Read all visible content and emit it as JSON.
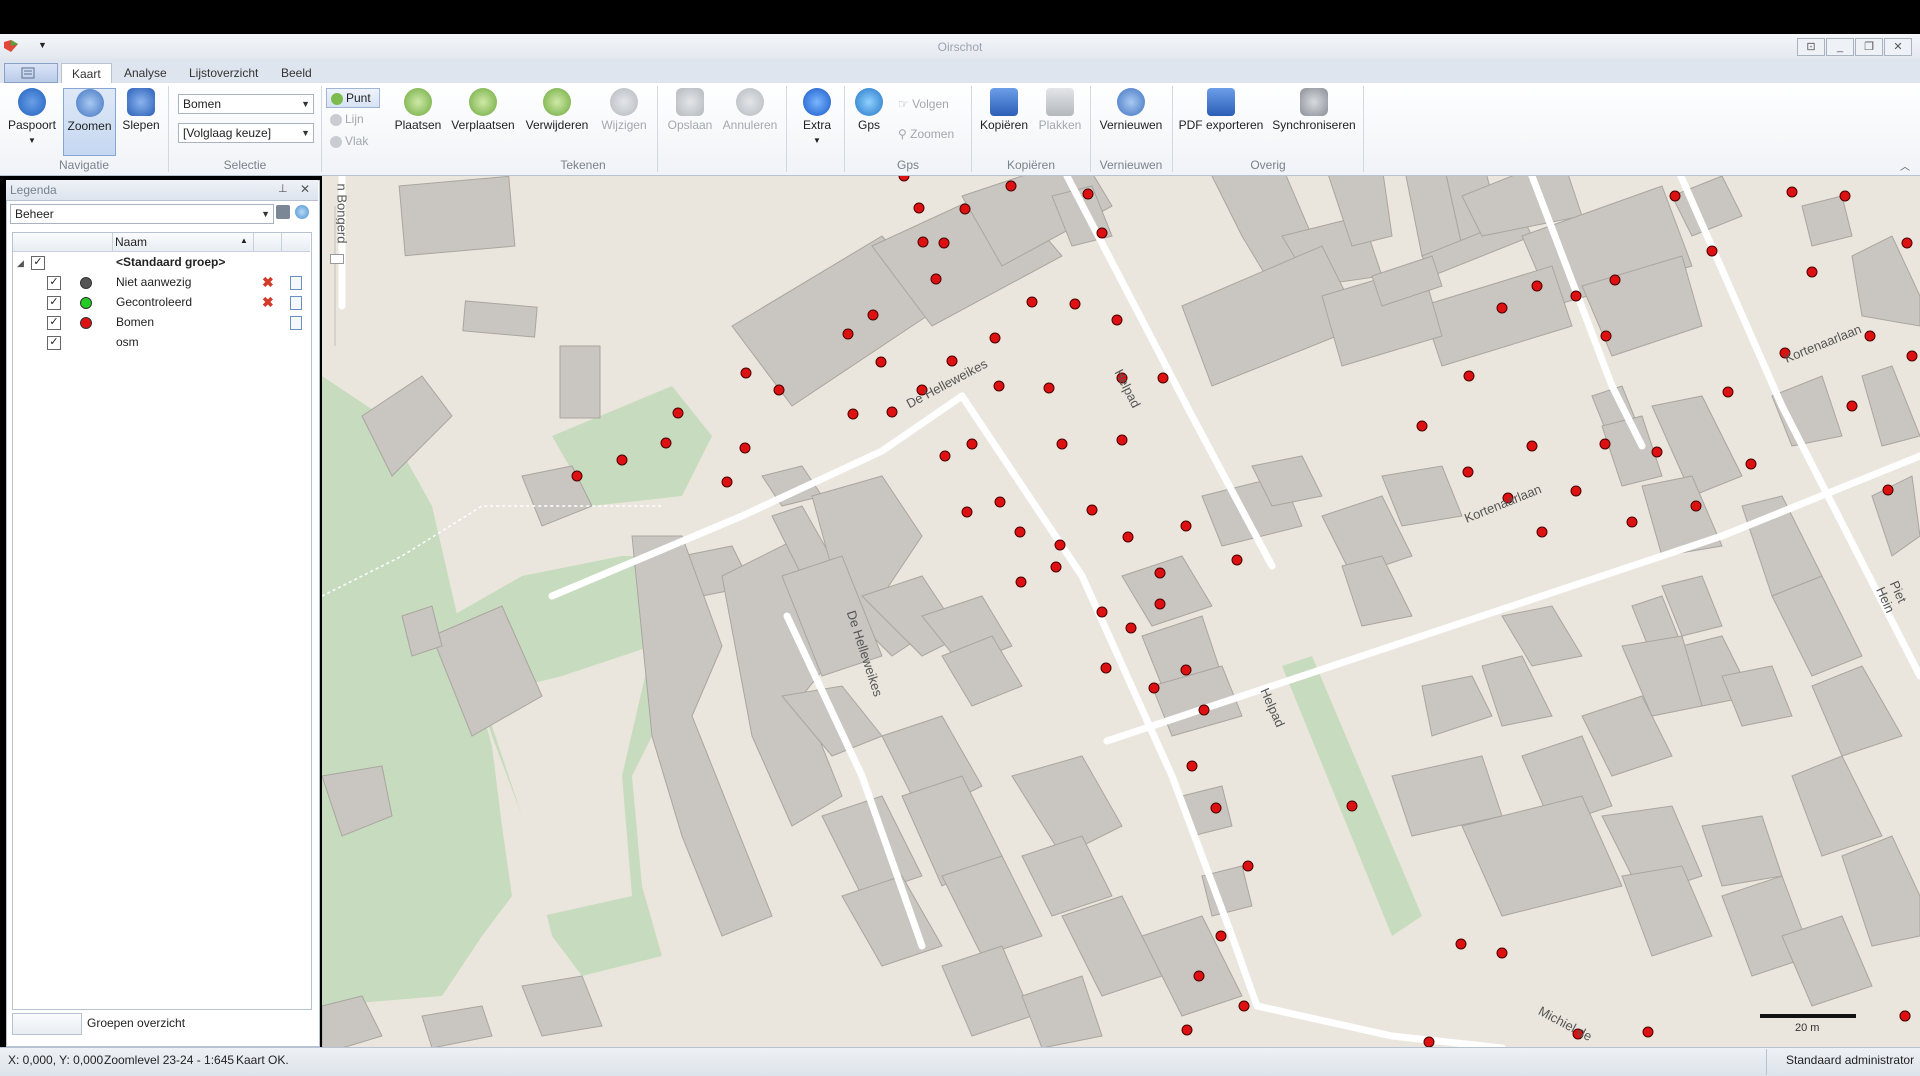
{
  "window": {
    "title": "Oirschot",
    "controls": [
      "restore-icon",
      "minimize-icon",
      "maximize-icon",
      "close-icon"
    ]
  },
  "tabs": [
    "Kaart",
    "Analyse",
    "Lijstoverzicht",
    "Beeld"
  ],
  "ribbon": {
    "navigatie": {
      "label": "Navigatie",
      "buttons": [
        "Paspoort",
        "Zoomen",
        "Slepen"
      ]
    },
    "selectie": {
      "label": "Selectie",
      "layer": "Bomen",
      "order": "[Volglaag keuze]"
    },
    "tekenen": {
      "label": "Tekenen",
      "shapes": [
        "Punt",
        "Lijn",
        "Vlak"
      ],
      "buttons": [
        "Plaatsen",
        "Verplaatsen",
        "Verwijderen",
        "Wijzigen",
        "Opslaan",
        "Annuleren",
        "Extra"
      ]
    },
    "gps": {
      "label": "Gps",
      "button": "Gps",
      "follow": "Volgen",
      "zoom": "Zoomen"
    },
    "kopieren": {
      "label": "Kopiëren",
      "buttons": [
        "Kopiëren",
        "Plakken"
      ]
    },
    "vernieuwen": {
      "label": "Vernieuwen",
      "button": "Vernieuwen"
    },
    "overig": {
      "label": "Overig",
      "buttons": [
        "PDF exporteren",
        "Synchroniseren"
      ]
    }
  },
  "legend": {
    "title": "Legenda",
    "profile": "Beheer",
    "column": "Naam",
    "group": "<Standaard groep>",
    "items": [
      {
        "name": "Niet aanwezig",
        "color": "#555555"
      },
      {
        "name": "Gecontroleerd",
        "color": "#22cc22"
      },
      {
        "name": "Bomen",
        "color": "#dd1111"
      },
      {
        "name": "osm",
        "color": ""
      }
    ],
    "footer": "Groepen overzicht"
  },
  "map": {
    "streets": [
      "De Helleweikes",
      "Helpad",
      "De Helleweikes",
      "Kortenaarlaan",
      "Kortenaarlaan",
      "Helpad",
      "Piet Hein",
      "Michiel de",
      "n Bongerd"
    ],
    "scale": "20 m"
  },
  "status": {
    "coords": "X: 0,000, Y: 0,000",
    "zoom": "Zoomlevel 23-24 - 1:645",
    "message": "Kaart OK.",
    "user": "Standaard administrator"
  },
  "colors": {
    "tree": "#dd1111",
    "building": "#c9c5c0",
    "park": "#c7dcbe",
    "road": "#ffffff",
    "background": "#ebe6dd"
  }
}
